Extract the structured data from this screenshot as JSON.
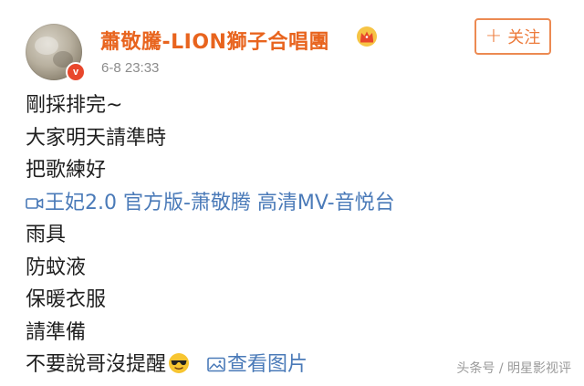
{
  "header": {
    "user_name": "蕭敬騰-LION獅子合唱團",
    "post_time": "6-8 23:33",
    "follow_label": "关注",
    "follow_plus": "+",
    "verified_mark": "v"
  },
  "post": {
    "lines": [
      "剛採排完~",
      "大家明天請準時",
      "把歌練好"
    ],
    "video_link": "王妃2.0 官方版-萧敬腾 高清MV-音悦台",
    "lines_after": [
      "雨具",
      "防蚊液",
      "保暖衣服",
      "請準備"
    ],
    "last_line": "不要說哥沒提醒",
    "view_image_label": "查看图片"
  },
  "watermark": "头条号 / 明星影视评",
  "colors": {
    "name": "#e8641e",
    "link": "#4a7ab8",
    "follow_border": "#ec8a52",
    "verified": "#e8472c"
  },
  "icons": {
    "crown": "crown-icon",
    "video": "video-icon",
    "emoji": "sunglasses-emoji-icon",
    "image": "image-icon"
  }
}
